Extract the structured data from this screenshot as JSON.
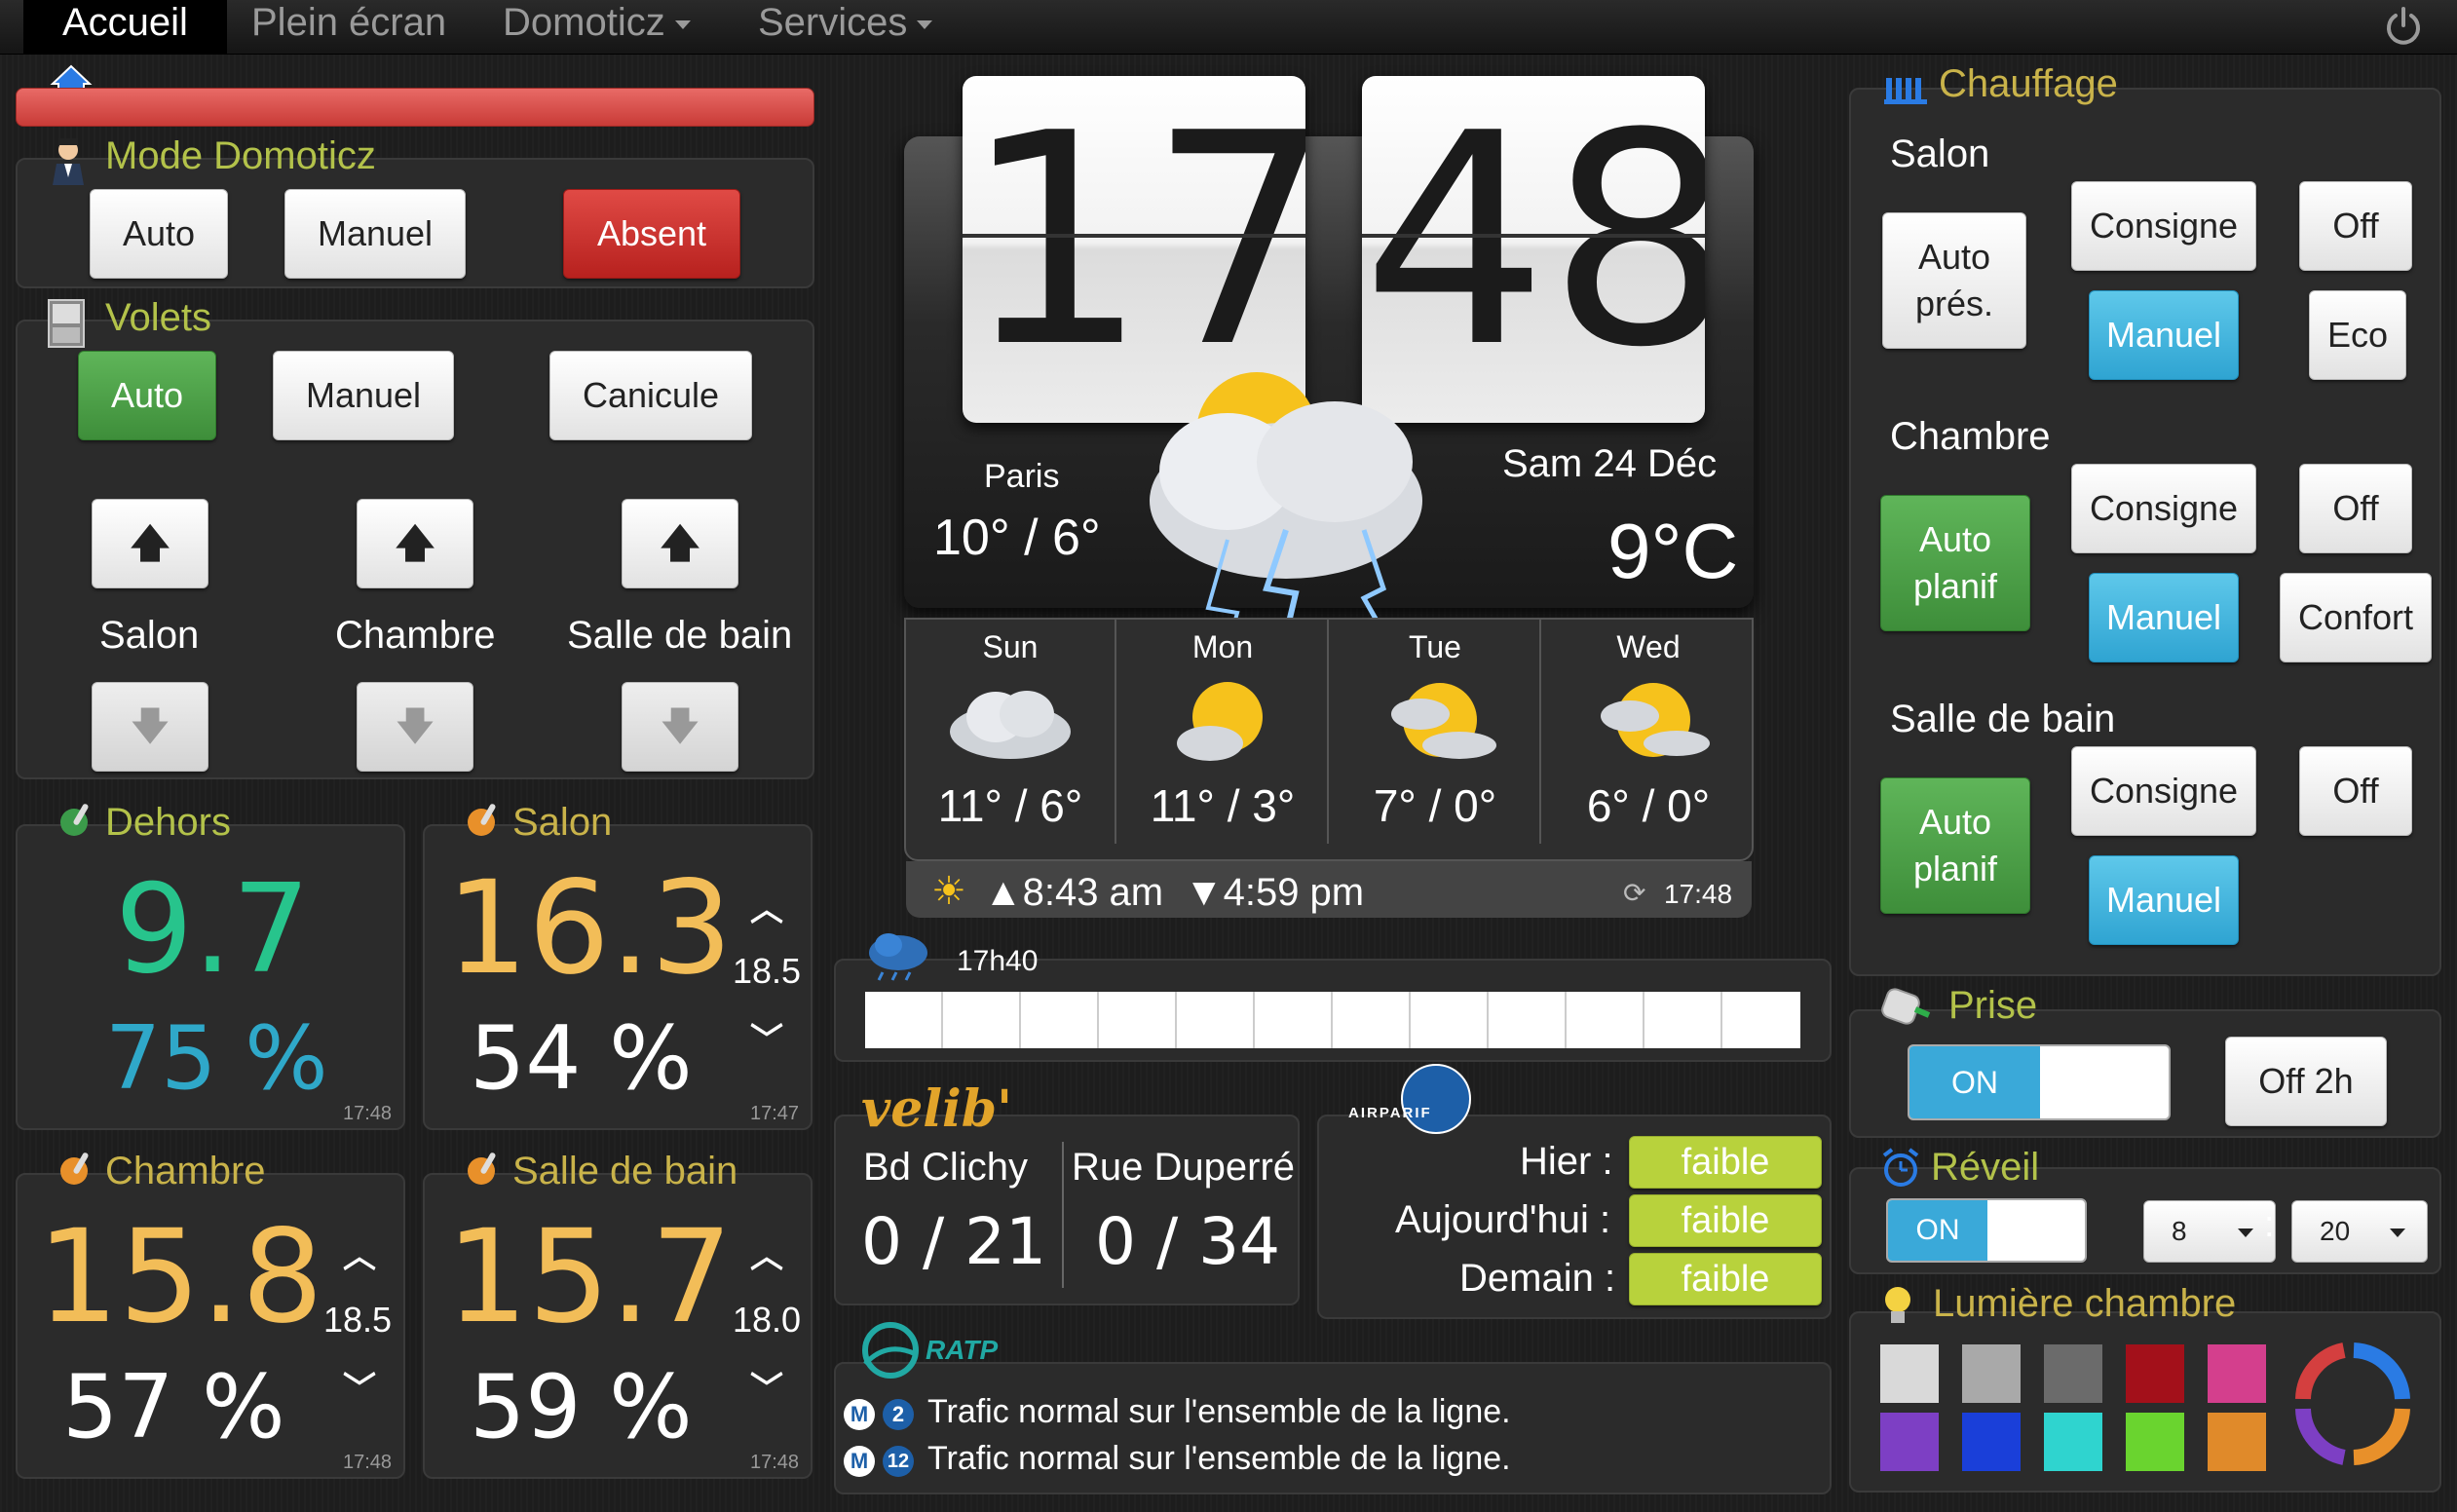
{
  "navbar": {
    "tabs": [
      "Accueil",
      "Plein écran",
      "Domoticz",
      "Services"
    ]
  },
  "mode": {
    "title": "Mode Domoticz",
    "buttons": [
      "Auto",
      "Manuel",
      "Absent"
    ]
  },
  "volets": {
    "title": "Volets",
    "buttons": [
      "Auto",
      "Manuel",
      "Canicule"
    ],
    "rooms": [
      "Salon",
      "Chambre",
      "Salle de bain"
    ]
  },
  "sensors": [
    {
      "title": "Dehors",
      "temp": "9.7",
      "humidity": "75 %",
      "time": "17:48"
    },
    {
      "title": "Salon",
      "temp": "16.3",
      "humidity": "54 %",
      "setpoint": "18.5",
      "time": "17:47"
    },
    {
      "title": "Chambre",
      "temp": "15.8",
      "humidity": "57 %",
      "setpoint": "18.5",
      "time": "17:48"
    },
    {
      "title": "Salle de bain",
      "temp": "15.7",
      "humidity": "59 %",
      "setpoint": "18.0",
      "time": "17:48"
    }
  ],
  "clock": {
    "hours": "17",
    "minutes": "48"
  },
  "weather": {
    "city": "Paris",
    "hilo": "10° / 6°",
    "date": "Sam 24 Déc",
    "current": "9°C",
    "forecast": [
      {
        "day": "Sun",
        "temps": "11° / 6°"
      },
      {
        "day": "Mon",
        "temps": "11° / 3°"
      },
      {
        "day": "Tue",
        "temps": "7° / 0°"
      },
      {
        "day": "Wed",
        "temps": "6° / 0°"
      }
    ],
    "sunrise": "▲8:43 am",
    "sunset": "▼4:59 pm",
    "updated": "17:48"
  },
  "rain": {
    "time": "17h40",
    "cells": 12
  },
  "velib": {
    "logo": "velib'",
    "stations": [
      {
        "name": "Bd Clichy",
        "value": "0 / 21"
      },
      {
        "name": "Rue Duperré",
        "value": "0 / 34"
      }
    ]
  },
  "airparif": {
    "logo_text": "AIRPARIF",
    "rows": [
      {
        "label": "Hier :",
        "value": "faible"
      },
      {
        "label": "Aujourd'hui :",
        "value": "faible"
      },
      {
        "label": "Demain :",
        "value": "faible"
      }
    ]
  },
  "ratp": {
    "logo": "RATP",
    "lines": [
      {
        "num": "2",
        "text": "Trafic normal sur l'ensemble de la ligne."
      },
      {
        "num": "12",
        "text": "Trafic normal sur l'ensemble de la ligne."
      }
    ]
  },
  "chauffage": {
    "title": "Chauffage",
    "rooms": [
      {
        "name": "Salon",
        "mode": "Auto prés.",
        "consigne": "Consigne",
        "manuel": "Manuel",
        "off": "Off",
        "extra": "Eco"
      },
      {
        "name": "Chambre",
        "mode": "Auto planif",
        "consigne": "Consigne",
        "manuel": "Manuel",
        "off": "Off",
        "extra": "Confort"
      },
      {
        "name": "Salle de bain",
        "mode": "Auto planif",
        "consigne": "Consigne",
        "manuel": "Manuel",
        "off": "Off"
      }
    ]
  },
  "prise": {
    "title": "Prise",
    "toggle": "ON",
    "button": "Off 2h"
  },
  "reveil": {
    "title": "Réveil",
    "toggle": "ON",
    "hour": "8",
    "separator": ":",
    "minute": "20"
  },
  "lumiere": {
    "title": "Lumière chambre",
    "colors": [
      "#d9d9d9",
      "#a9a9a9",
      "#6b6b6b",
      "#a3101a",
      "#d43f8d",
      "#7d3fc4",
      "#1a3fd9",
      "#2fd4cf",
      "#6ad42f",
      "#e08a2a"
    ]
  },
  "colors": {
    "accent_title": "#c9b34a",
    "temp_orange": "#f2bd58",
    "temp_green": "#27c48c",
    "humidity_blue": "#2fa8c9",
    "blue_button": "#2fa4d2"
  }
}
